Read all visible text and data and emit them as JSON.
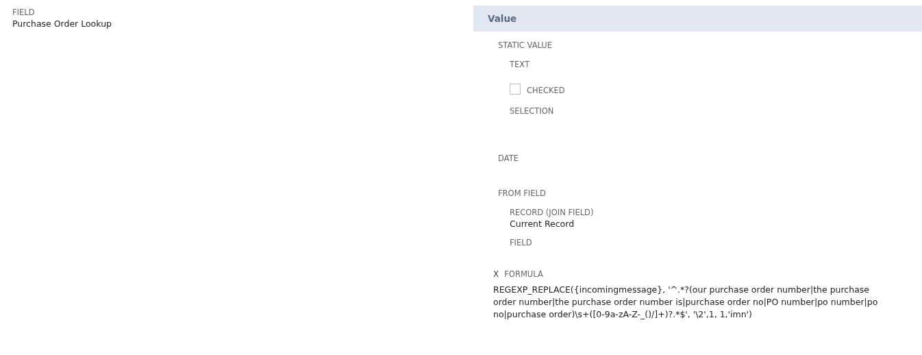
{
  "field": {
    "label": "FIELD",
    "value": "Purchase Order Lookup"
  },
  "value_panel": {
    "title": "Value",
    "static_value": {
      "label": "STATIC VALUE",
      "text_label": "TEXT",
      "checkbox": {
        "label": "CHECKED",
        "checked": false
      },
      "selection_label": "SELECTION"
    },
    "date_label": "DATE",
    "from_field": {
      "label": "FROM FIELD",
      "record_label": "RECORD (JOIN FIELD)",
      "record_value": "Current Record",
      "field_label": "FIELD"
    },
    "formula": {
      "marker": "X",
      "label": "FORMULA",
      "value": "REGEXP_REPLACE({incomingmessage}, '^.*?(our purchase order number|the purchase order number|the purchase order number is|purchase order no|PO number|po number|po no|purchase order)\\s+([0-9a-zA-Z-_()/]+)?.*$', '\\2',1, 1,'imn')"
    }
  }
}
